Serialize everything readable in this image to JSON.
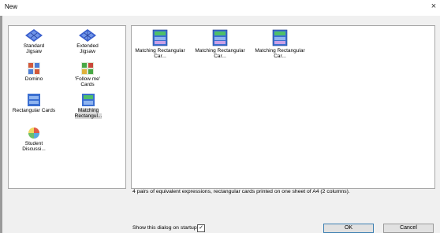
{
  "window": {
    "title": "New",
    "close_glyph": "×"
  },
  "templates": [
    {
      "label": "Standard Jigsaw",
      "icon": "jigsaw-icon"
    },
    {
      "label": "Extended Jigsaw",
      "icon": "jigsaw-icon"
    },
    {
      "label": "Domino",
      "icon": "domino-icon"
    },
    {
      "label": "'Follow me' Cards",
      "icon": "follow-me-icon"
    },
    {
      "label": "Rectangular Cards",
      "icon": "rectangular-cards-icon"
    },
    {
      "label": "Matching Rectangul...",
      "icon": "matching-cards-icon",
      "selected": true
    },
    {
      "label": "Student Discussi...",
      "icon": "discussion-icon"
    }
  ],
  "files": [
    {
      "label": "Matching Rectangular Car...",
      "icon": "matching-cards-file-icon"
    },
    {
      "label": "Matching Rectangular Car...",
      "icon": "matching-cards-file-icon"
    },
    {
      "label": "Matching Rectangular Car...",
      "icon": "matching-cards-file-icon"
    }
  ],
  "description": "4 pairs of equivalent expressions, rectangular cards printed on one sheet of A4 (2 columns).",
  "startup": {
    "label": "Show this dialog on startup",
    "checked": true,
    "check_glyph": "✓"
  },
  "buttons": {
    "ok": "OK",
    "cancel": "Cancel"
  }
}
